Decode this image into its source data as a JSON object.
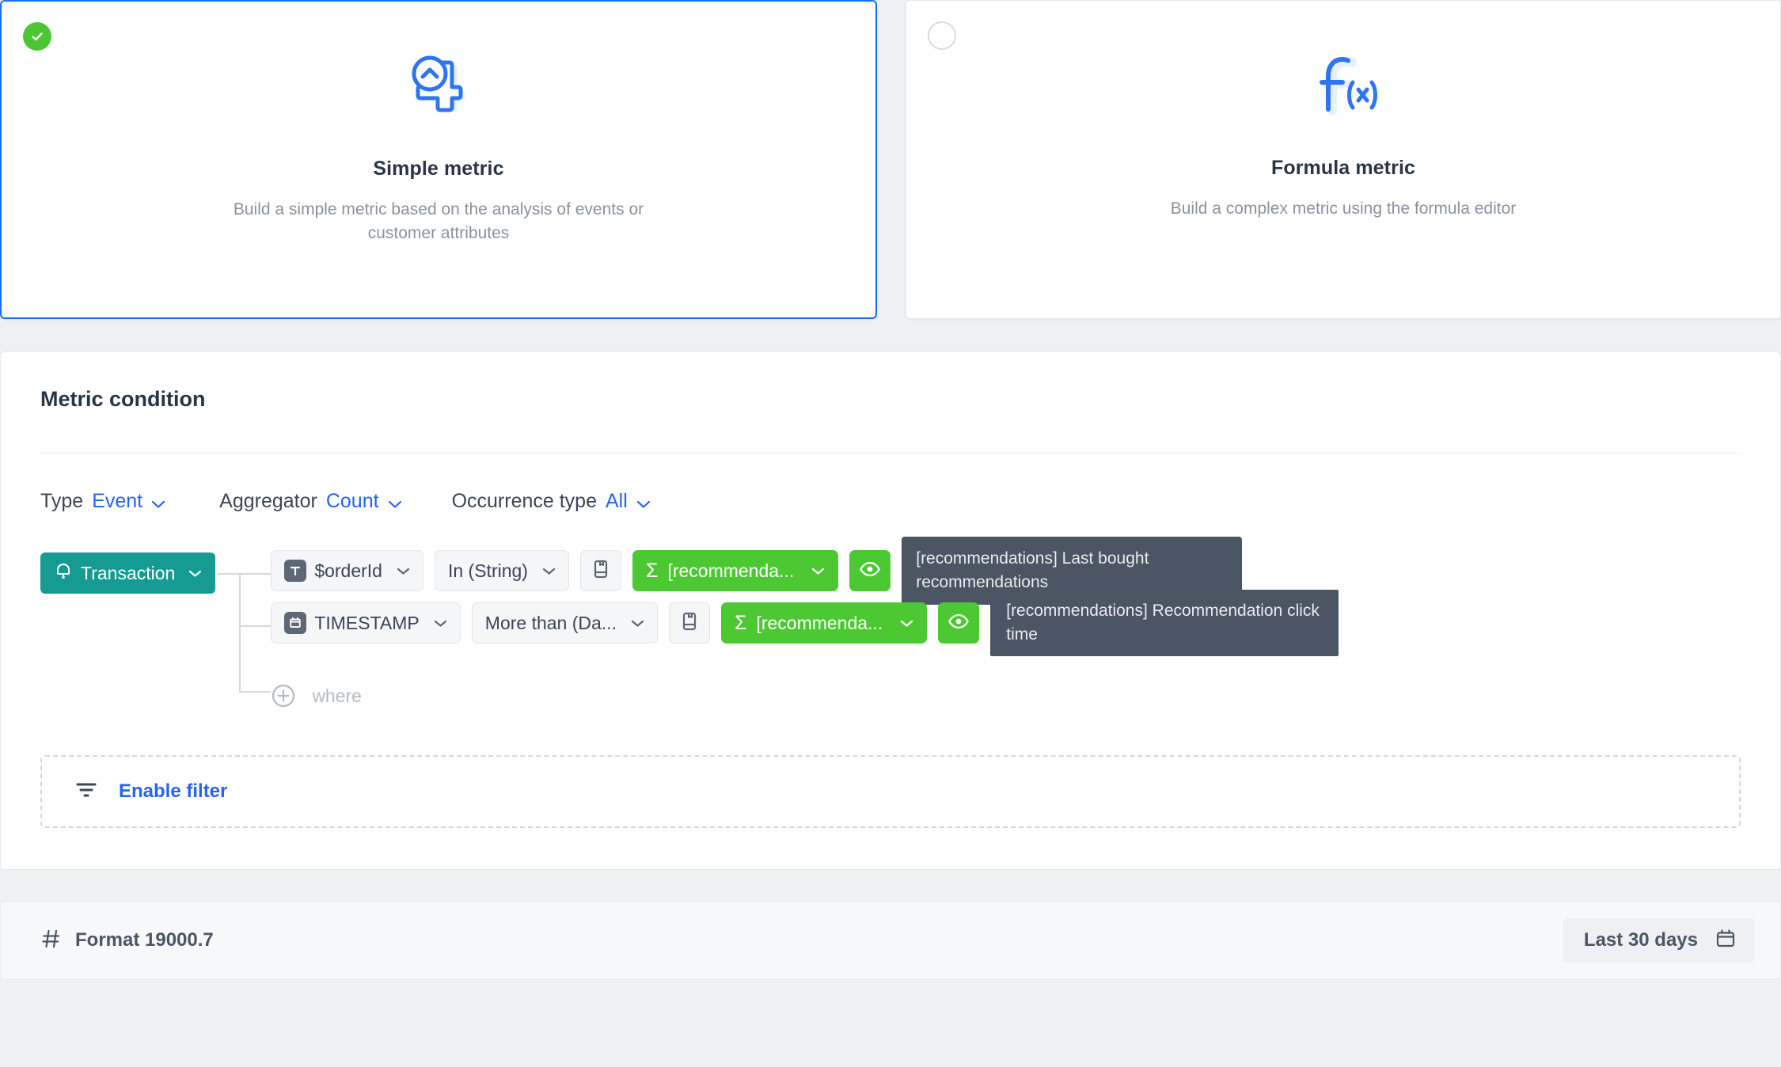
{
  "metric_type_cards": [
    {
      "id": "simple-metric",
      "title": "Simple metric",
      "description": "Build a simple metric based on the analysis of events or customer attributes",
      "selected": true,
      "icon": "number-four-chevron-icon"
    },
    {
      "id": "formula-metric",
      "title": "Formula metric",
      "description": "Build a complex metric using the formula editor",
      "selected": false,
      "icon": "function-fx-icon"
    }
  ],
  "metric_condition": {
    "title": "Metric condition",
    "selectors": [
      {
        "label": "Type",
        "value": "Event"
      },
      {
        "label": "Aggregator",
        "value": "Count"
      },
      {
        "label": "Occurrence type",
        "value": "All"
      }
    ],
    "event": {
      "label": "Transaction",
      "icon": "bell-icon"
    },
    "conditions": [
      {
        "attribute": "$orderId",
        "attribute_icon": "text-type-icon",
        "operator": "In (String)",
        "book_icon": "book-icon",
        "value_chip": "[recommenda...",
        "value_icon": "sigma-icon",
        "eye_icon": "eye-icon",
        "tooltip": "[recommendations] Last bought recommendations"
      },
      {
        "attribute": "TIMESTAMP",
        "attribute_icon": "calendar-icon",
        "operator": "More than (Da...",
        "book_icon": "book-icon",
        "value_chip": "[recommenda...",
        "value_icon": "sigma-icon",
        "eye_icon": "eye-icon",
        "tooltip": "[recommendations] Recommendation click time"
      }
    ],
    "add_where": {
      "label": "where",
      "icon": "plus-circle-icon"
    },
    "enable_filter": {
      "label": "Enable filter",
      "icon": "filter-icon"
    }
  },
  "footer": {
    "format": {
      "label": "Format 19000.7",
      "icon": "hash-icon"
    },
    "date_range": {
      "label": "Last 30 days",
      "icon": "calendar-icon"
    }
  },
  "colors": {
    "accent_blue": "#2563f0",
    "selected_border": "#1a6bf5",
    "green": "#4cc932",
    "check_green": "#4bc734",
    "teal": "#169b93",
    "tooltip_bg": "#4b5563",
    "page_bg": "#eef1f2",
    "card_bg": "#ffffff",
    "footer_bg": "#f7f8fa"
  }
}
